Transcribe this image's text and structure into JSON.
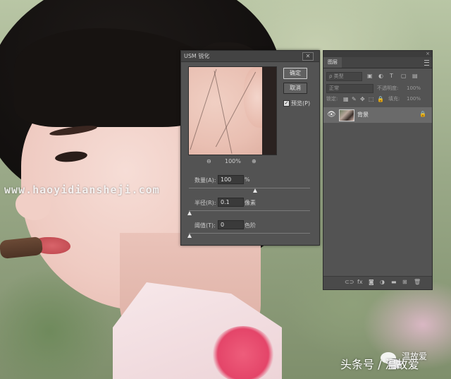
{
  "watermark": {
    "url": "www.haoyidiansheji.com"
  },
  "usm_dialog": {
    "title": "USM 锐化",
    "close_glyph": "✕",
    "ok_label": "确定",
    "cancel_label": "取消",
    "preview_label": "预览(P)",
    "preview_checked": true,
    "zoom_out_glyph": "⊖",
    "zoom_in_glyph": "⊕",
    "zoom_level": "100%",
    "amount": {
      "label": "数量(A):",
      "value": "100",
      "unit": "%"
    },
    "radius": {
      "label": "半径(R):",
      "value": "0.1",
      "unit": "像素"
    },
    "threshold": {
      "label": "阈值(T):",
      "value": "0",
      "unit": "色阶"
    }
  },
  "layers_panel": {
    "close_glyph": "×",
    "tab_label": "图层",
    "filter_kind": "ρ 类型",
    "blend_mode": "正常",
    "opacity_label": "不透明度:",
    "opacity_value": "100%",
    "lock_label": "锁定:",
    "fill_label": "填充:",
    "fill_value": "100%",
    "layers": [
      {
        "name": "背景",
        "visible": true,
        "locked": true
      }
    ],
    "bottom_icons": [
      "link-icon",
      "fx-icon",
      "mask-icon",
      "adjustment-icon",
      "folder-icon",
      "new-layer-icon",
      "trash-icon"
    ]
  },
  "footer": {
    "handle_top": "温故爱",
    "credit": "头条号 / 温故爱"
  }
}
